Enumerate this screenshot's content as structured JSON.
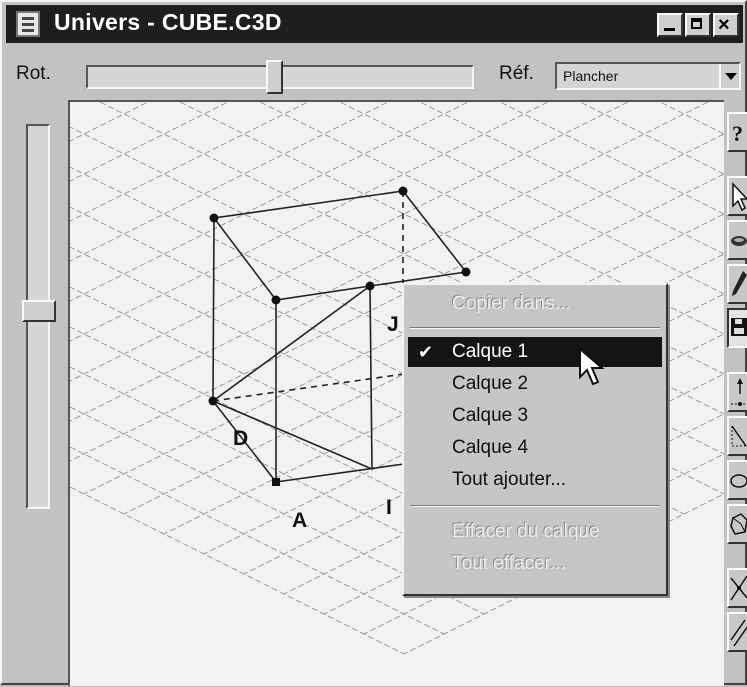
{
  "window": {
    "title": "Univers - CUBE.C3D",
    "icon": "document-icon",
    "controls": [
      "minimize-icon",
      "maximize-icon",
      "close-icon"
    ]
  },
  "toolbar_top": {
    "rotation_label": "Rot.",
    "reference_label": "Réf.",
    "reference_value": "Plancher"
  },
  "figure": {
    "point_labels": [
      "J",
      "D",
      "A",
      "I"
    ]
  },
  "context_menu": {
    "copy_to": "Copier dans...",
    "layers": [
      {
        "label": "Calque 1",
        "checked": true
      },
      {
        "label": "Calque 2",
        "checked": false
      },
      {
        "label": "Calque 3",
        "checked": false
      },
      {
        "label": "Calque 4",
        "checked": false
      }
    ],
    "add_all": "Tout ajouter...",
    "clear_layer": "Effacer du calque",
    "clear_all": "Tout effacer...",
    "check_mark": "✔"
  },
  "right_toolbar": {
    "tools": [
      "help-icon",
      "pointer-arrow-icon",
      "ellipse-shape-icon",
      "pen-icon",
      "floppy-disk-icon",
      "point-icon",
      "segment-icon",
      "circle-icon",
      "polyhedron-icon",
      "intersection-icon",
      "parallel-lines-icon"
    ]
  },
  "colors": {
    "title_bar": "#1e1e1e",
    "window_gray": "#c2c2c2",
    "canvas": "#f2f2f2",
    "menu_highlight": "#141414"
  }
}
